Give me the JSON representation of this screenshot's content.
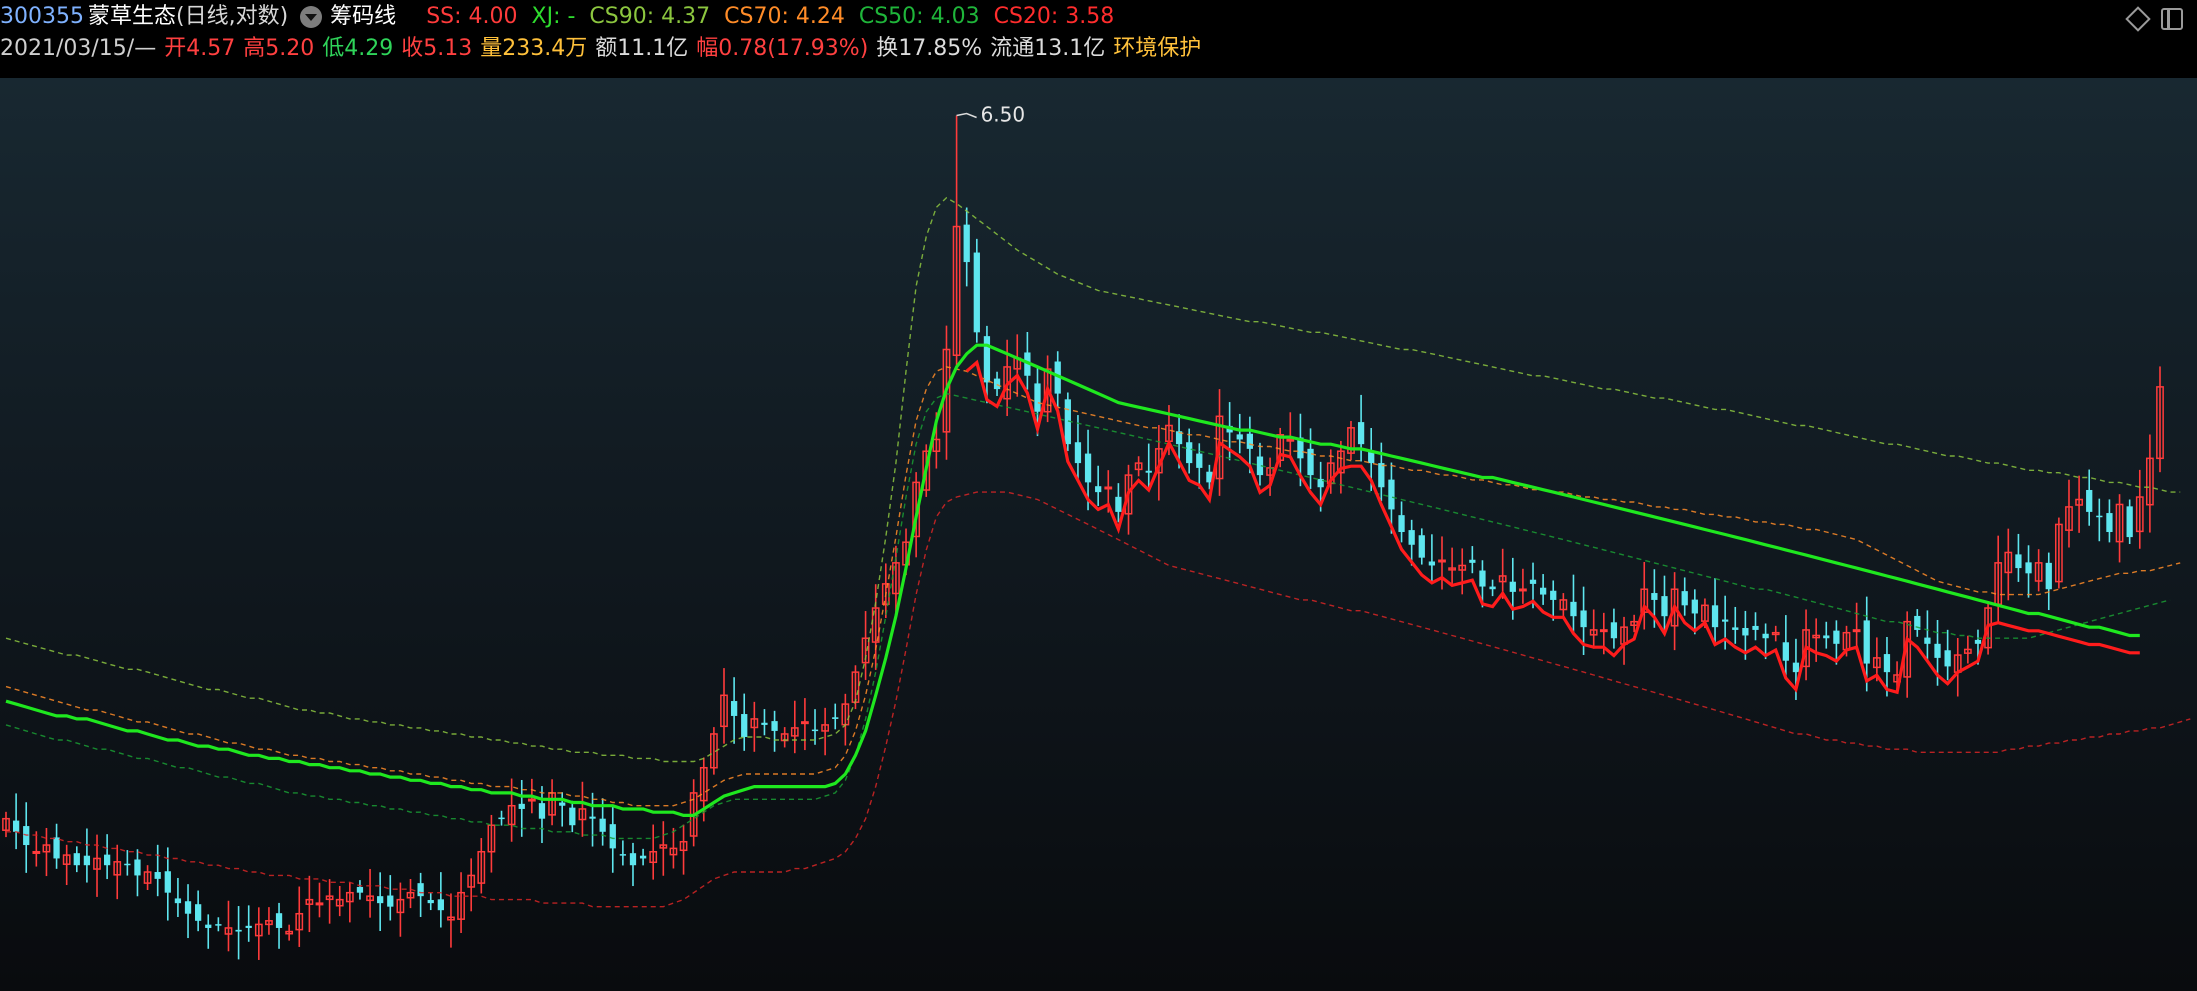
{
  "header": {
    "code": "300355",
    "name": "蒙草生态",
    "period": "(日线,对数)",
    "indicator_name": "筹码线",
    "ss": "SS: 4.00",
    "xj": "XJ: -",
    "cs90": "CS90: 4.37",
    "cs70": "CS70: 4.24",
    "cs50": "CS50: 4.03",
    "cs20": "CS20: 3.58",
    "date": "2021/03/15/—",
    "open_label": "开",
    "open": "4.57",
    "high_label": "高",
    "high": "5.20",
    "low_label": "低",
    "low": "4.29",
    "close_label": "收",
    "close": "5.13",
    "volume_label": "量",
    "volume": "233.4万",
    "amount_label": "额",
    "amount": "11.1亿",
    "change_label": "幅",
    "change": "0.78(17.93%)",
    "turnover_label": "换",
    "turnover": "17.85%",
    "float_label": "流通",
    "float": "13.1亿",
    "concept": "环境保护"
  },
  "icons": [
    "diamond-icon",
    "panel-toggle-icon"
  ],
  "colors": {
    "up": "#ff3b3b",
    "down": "#5ee6ef",
    "ss": "#ff1c1c",
    "xj": "#1fe81f",
    "cs90": "#8cc63f",
    "cs70": "#ff8c28",
    "cs50": "#1a9e34",
    "cs20": "#d82626"
  },
  "chart_data": {
    "type": "candlestick",
    "scale": "log",
    "ylim": [
      3.05,
      6.6
    ],
    "peak_label": "6.50",
    "peak_index": 94,
    "series_names": [
      "SS",
      "XJ",
      "CS90",
      "CS70",
      "CS50",
      "CS20"
    ],
    "closes": [
      3.52,
      3.48,
      3.44,
      3.42,
      3.44,
      3.4,
      3.41,
      3.38,
      3.38,
      3.4,
      3.38,
      3.39,
      3.38,
      3.35,
      3.36,
      3.34,
      3.3,
      3.27,
      3.24,
      3.22,
      3.2,
      3.21,
      3.2,
      3.19,
      3.2,
      3.21,
      3.22,
      3.2,
      3.19,
      3.24,
      3.28,
      3.27,
      3.29,
      3.28,
      3.3,
      3.3,
      3.29,
      3.27,
      3.26,
      3.28,
      3.3,
      3.29,
      3.27,
      3.25,
      3.23,
      3.3,
      3.35,
      3.42,
      3.5,
      3.52,
      3.56,
      3.55,
      3.58,
      3.52,
      3.6,
      3.56,
      3.5,
      3.55,
      3.52,
      3.48,
      3.43,
      3.41,
      3.38,
      3.4,
      3.42,
      3.44,
      3.43,
      3.45,
      3.6,
      3.68,
      3.79,
      3.92,
      3.85,
      3.78,
      3.84,
      3.82,
      3.8,
      3.79,
      3.81,
      3.83,
      3.8,
      3.82,
      3.84,
      3.89,
      4.0,
      4.12,
      4.23,
      4.32,
      4.4,
      4.48,
      4.72,
      4.85,
      4.9,
      5.3,
      5.9,
      5.72,
      5.38,
      5.15,
      5.12,
      5.22,
      5.26,
      5.18,
      5.02,
      5.21,
      5.1,
      4.88,
      4.8,
      4.72,
      4.68,
      4.7,
      4.6,
      4.75,
      4.8,
      4.76,
      4.86,
      4.96,
      4.88,
      4.8,
      4.78,
      4.72,
      5.0,
      4.93,
      4.9,
      4.86,
      4.75,
      4.78,
      4.92,
      4.9,
      4.82,
      4.75,
      4.7,
      4.8,
      4.85,
      4.95,
      4.88,
      4.8,
      4.7,
      4.61,
      4.52,
      4.47,
      4.42,
      4.39,
      4.41,
      4.38,
      4.39,
      4.4,
      4.31,
      4.3,
      4.35,
      4.29,
      4.3,
      4.32,
      4.28,
      4.26,
      4.26,
      4.2,
      4.16,
      4.15,
      4.15,
      4.12,
      4.16,
      4.18,
      4.3,
      4.26,
      4.2,
      4.3,
      4.24,
      4.21,
      4.24,
      4.16,
      4.18,
      4.15,
      4.13,
      4.15,
      4.12,
      4.14,
      4.04,
      4.0,
      4.15,
      4.13,
      4.12,
      4.1,
      4.14,
      4.15,
      4.03,
      4.05,
      4.0,
      3.99,
      4.18,
      4.15,
      4.1,
      4.05,
      4.02,
      4.06,
      4.08,
      4.1,
      4.23,
      4.4,
      4.44,
      4.38,
      4.36,
      4.4,
      4.3,
      4.55,
      4.62,
      4.65,
      4.6,
      4.58,
      4.52,
      4.63,
      4.5,
      4.66,
      4.82,
      5.13
    ],
    "ss": [
      3.9,
      3.89,
      3.88,
      3.87,
      3.86,
      3.85,
      3.85,
      3.84,
      3.84,
      3.83,
      3.82,
      3.81,
      3.8,
      3.8,
      3.79,
      3.78,
      3.77,
      3.77,
      3.76,
      3.75,
      3.75,
      3.74,
      3.74,
      3.73,
      3.72,
      3.72,
      3.71,
      3.71,
      3.7,
      3.7,
      3.69,
      3.69,
      3.68,
      3.68,
      3.67,
      3.67,
      3.66,
      3.66,
      3.65,
      3.65,
      3.64,
      3.64,
      3.63,
      3.63,
      3.62,
      3.62,
      3.61,
      3.61,
      3.6,
      3.6,
      3.6,
      3.59,
      3.59,
      3.58,
      3.58,
      3.58,
      3.57,
      3.57,
      3.56,
      3.56,
      3.56,
      3.55,
      3.55,
      3.55,
      3.54,
      3.54,
      3.54,
      3.53,
      3.53,
      3.55,
      3.57,
      3.59,
      3.6,
      3.61,
      3.62,
      3.62,
      3.62,
      3.62,
      3.62,
      3.62,
      3.62,
      3.62,
      3.63,
      3.66,
      3.72,
      3.8,
      3.92,
      4.05,
      4.2,
      4.38,
      4.58,
      4.78,
      4.98,
      5.12,
      5.22,
      5.28,
      5.32,
      5.32,
      5.3,
      5.28,
      5.26,
      5.24,
      5.22,
      5.2,
      5.18,
      5.16,
      5.14,
      5.12,
      5.1,
      5.08,
      5.06,
      5.05,
      5.04,
      5.03,
      5.02,
      5.01,
      5.0,
      4.99,
      4.98,
      4.97,
      4.96,
      4.95,
      4.94,
      4.94,
      4.93,
      4.92,
      4.91,
      4.91,
      4.9,
      4.89,
      4.88,
      4.88,
      4.87,
      4.86,
      4.86,
      4.85,
      4.84,
      4.83,
      4.82,
      4.81,
      4.8,
      4.79,
      4.78,
      4.77,
      4.76,
      4.75,
      4.74,
      4.74,
      4.73,
      4.72,
      4.71,
      4.7,
      4.69,
      4.68,
      4.67,
      4.66,
      4.65,
      4.64,
      4.63,
      4.62,
      4.61,
      4.6,
      4.59,
      4.58,
      4.57,
      4.56,
      4.55,
      4.54,
      4.53,
      4.52,
      4.51,
      4.5,
      4.49,
      4.48,
      4.47,
      4.46,
      4.45,
      4.44,
      4.43,
      4.42,
      4.41,
      4.4,
      4.39,
      4.38,
      4.37,
      4.36,
      4.35,
      4.34,
      4.33,
      4.32,
      4.31,
      4.3,
      4.29,
      4.28,
      4.27,
      4.26,
      4.25,
      4.24,
      4.23,
      4.22,
      4.21,
      4.21,
      4.2,
      4.19,
      4.18,
      4.17,
      4.16,
      4.16,
      4.15,
      4.14,
      4.13,
      4.13
    ],
    "xj_start": 95,
    "cs90": [
      4.12,
      4.11,
      4.1,
      4.09,
      4.08,
      4.07,
      4.06,
      4.06,
      4.05,
      4.04,
      4.03,
      4.02,
      4.01,
      4.01,
      4.0,
      3.99,
      3.98,
      3.97,
      3.96,
      3.95,
      3.94,
      3.94,
      3.93,
      3.92,
      3.91,
      3.91,
      3.9,
      3.89,
      3.88,
      3.87,
      3.87,
      3.86,
      3.86,
      3.85,
      3.84,
      3.84,
      3.83,
      3.83,
      3.82,
      3.82,
      3.81,
      3.81,
      3.8,
      3.8,
      3.79,
      3.79,
      3.78,
      3.78,
      3.77,
      3.77,
      3.76,
      3.76,
      3.75,
      3.75,
      3.74,
      3.74,
      3.73,
      3.73,
      3.73,
      3.72,
      3.72,
      3.72,
      3.71,
      3.71,
      3.71,
      3.7,
      3.7,
      3.7,
      3.7,
      3.71,
      3.73,
      3.75,
      3.77,
      3.78,
      3.78,
      3.78,
      3.77,
      3.77,
      3.77,
      3.77,
      3.77,
      3.78,
      3.79,
      3.82,
      3.9,
      4.05,
      4.25,
      4.5,
      4.8,
      5.2,
      5.6,
      5.85,
      6.0,
      6.05,
      6.02,
      5.98,
      5.94,
      5.9,
      5.86,
      5.82,
      5.78,
      5.75,
      5.72,
      5.69,
      5.66,
      5.64,
      5.62,
      5.6,
      5.58,
      5.57,
      5.56,
      5.55,
      5.54,
      5.53,
      5.52,
      5.51,
      5.5,
      5.49,
      5.48,
      5.47,
      5.46,
      5.45,
      5.44,
      5.43,
      5.43,
      5.42,
      5.41,
      5.4,
      5.39,
      5.38,
      5.38,
      5.37,
      5.36,
      5.35,
      5.34,
      5.33,
      5.32,
      5.31,
      5.3,
      5.3,
      5.29,
      5.28,
      5.27,
      5.26,
      5.25,
      5.24,
      5.23,
      5.22,
      5.21,
      5.2,
      5.19,
      5.18,
      5.18,
      5.17,
      5.16,
      5.15,
      5.14,
      5.13,
      5.12,
      5.12,
      5.11,
      5.1,
      5.09,
      5.08,
      5.08,
      5.07,
      5.06,
      5.05,
      5.04,
      5.03,
      5.03,
      5.02,
      5.01,
      5.0,
      4.99,
      4.98,
      4.97,
      4.96,
      4.96,
      4.95,
      4.94,
      4.93,
      4.92,
      4.91,
      4.9,
      4.89,
      4.88,
      4.88,
      4.87,
      4.86,
      4.85,
      4.84,
      4.83,
      4.83,
      4.82,
      4.81,
      4.8,
      4.8,
      4.79,
      4.78,
      4.77,
      4.77,
      4.76,
      4.76,
      4.75,
      4.74,
      4.74,
      4.73,
      4.72,
      4.72,
      4.71,
      4.7,
      4.7,
      4.69,
      4.68,
      4.68
    ],
    "cs70": [
      3.95,
      3.94,
      3.93,
      3.92,
      3.91,
      3.9,
      3.89,
      3.88,
      3.87,
      3.87,
      3.86,
      3.85,
      3.84,
      3.83,
      3.83,
      3.82,
      3.81,
      3.8,
      3.79,
      3.79,
      3.78,
      3.77,
      3.76,
      3.76,
      3.75,
      3.74,
      3.74,
      3.73,
      3.72,
      3.72,
      3.71,
      3.71,
      3.7,
      3.7,
      3.69,
      3.69,
      3.68,
      3.68,
      3.67,
      3.67,
      3.66,
      3.66,
      3.65,
      3.65,
      3.64,
      3.64,
      3.63,
      3.63,
      3.62,
      3.62,
      3.62,
      3.61,
      3.61,
      3.6,
      3.6,
      3.6,
      3.59,
      3.59,
      3.58,
      3.58,
      3.57,
      3.57,
      3.56,
      3.56,
      3.56,
      3.56,
      3.56,
      3.57,
      3.58,
      3.6,
      3.62,
      3.64,
      3.65,
      3.66,
      3.66,
      3.66,
      3.66,
      3.66,
      3.66,
      3.66,
      3.66,
      3.67,
      3.68,
      3.72,
      3.8,
      3.92,
      4.08,
      4.28,
      4.5,
      4.75,
      4.98,
      5.12,
      5.2,
      5.22,
      5.21,
      5.2,
      5.18,
      5.16,
      5.14,
      5.12,
      5.1,
      5.08,
      5.06,
      5.05,
      5.04,
      5.03,
      5.02,
      5.01,
      5.0,
      4.99,
      4.98,
      4.97,
      4.96,
      4.95,
      4.95,
      4.94,
      4.93,
      4.92,
      4.92,
      4.91,
      4.9,
      4.89,
      4.89,
      4.88,
      4.87,
      4.87,
      4.86,
      4.85,
      4.85,
      4.84,
      4.83,
      4.83,
      4.82,
      4.81,
      4.81,
      4.8,
      4.79,
      4.79,
      4.78,
      4.77,
      4.77,
      4.76,
      4.75,
      4.75,
      4.74,
      4.73,
      4.73,
      4.72,
      4.71,
      4.71,
      4.7,
      4.69,
      4.69,
      4.68,
      4.68,
      4.67,
      4.66,
      4.66,
      4.65,
      4.65,
      4.64,
      4.64,
      4.63,
      4.62,
      4.62,
      4.61,
      4.61,
      4.6,
      4.59,
      4.59,
      4.58,
      4.58,
      4.57,
      4.56,
      4.56,
      4.55,
      4.55,
      4.54,
      4.53,
      4.53,
      4.52,
      4.51,
      4.5,
      4.49,
      4.47,
      4.45,
      4.43,
      4.41,
      4.39,
      4.37,
      4.35,
      4.33,
      4.32,
      4.31,
      4.3,
      4.29,
      4.29,
      4.28,
      4.28,
      4.28,
      4.28,
      4.28,
      4.29,
      4.3,
      4.31,
      4.32,
      4.33,
      4.34,
      4.35,
      4.36,
      4.36,
      4.37,
      4.37,
      4.38,
      4.39,
      4.4
    ],
    "cs50": [
      3.82,
      3.81,
      3.8,
      3.79,
      3.78,
      3.77,
      3.77,
      3.76,
      3.75,
      3.74,
      3.74,
      3.73,
      3.72,
      3.71,
      3.71,
      3.7,
      3.69,
      3.68,
      3.68,
      3.67,
      3.66,
      3.65,
      3.65,
      3.64,
      3.63,
      3.63,
      3.62,
      3.61,
      3.6,
      3.6,
      3.59,
      3.59,
      3.58,
      3.58,
      3.57,
      3.57,
      3.56,
      3.56,
      3.55,
      3.55,
      3.54,
      3.54,
      3.53,
      3.53,
      3.52,
      3.52,
      3.51,
      3.51,
      3.5,
      3.5,
      3.5,
      3.49,
      3.49,
      3.49,
      3.48,
      3.48,
      3.48,
      3.47,
      3.47,
      3.47,
      3.46,
      3.46,
      3.46,
      3.46,
      3.46,
      3.47,
      3.48,
      3.5,
      3.52,
      3.54,
      3.56,
      3.57,
      3.58,
      3.58,
      3.58,
      3.58,
      3.58,
      3.58,
      3.58,
      3.58,
      3.58,
      3.59,
      3.6,
      3.64,
      3.72,
      3.84,
      4.0,
      4.2,
      4.42,
      4.66,
      4.88,
      5.02,
      5.08,
      5.1,
      5.09,
      5.08,
      5.07,
      5.06,
      5.05,
      5.04,
      5.03,
      5.02,
      5.01,
      5.0,
      4.99,
      4.98,
      4.97,
      4.96,
      4.95,
      4.94,
      4.93,
      4.92,
      4.91,
      4.9,
      4.89,
      4.88,
      4.87,
      4.86,
      4.85,
      4.84,
      4.83,
      4.82,
      4.81,
      4.8,
      4.79,
      4.78,
      4.77,
      4.76,
      4.75,
      4.74,
      4.73,
      4.72,
      4.71,
      4.7,
      4.69,
      4.68,
      4.67,
      4.66,
      4.65,
      4.64,
      4.63,
      4.62,
      4.61,
      4.6,
      4.59,
      4.58,
      4.57,
      4.56,
      4.55,
      4.54,
      4.53,
      4.52,
      4.51,
      4.5,
      4.49,
      4.48,
      4.47,
      4.46,
      4.45,
      4.44,
      4.43,
      4.42,
      4.41,
      4.4,
      4.39,
      4.38,
      4.37,
      4.36,
      4.35,
      4.34,
      4.33,
      4.32,
      4.31,
      4.3,
      4.3,
      4.29,
      4.28,
      4.27,
      4.26,
      4.25,
      4.24,
      4.23,
      4.22,
      4.21,
      4.2,
      4.19,
      4.18,
      4.18,
      4.17,
      4.16,
      4.15,
      4.14,
      4.14,
      4.13,
      4.13,
      4.12,
      4.12,
      4.12,
      4.12,
      4.12,
      4.12,
      4.13,
      4.14,
      4.15,
      4.16,
      4.17,
      4.18,
      4.19,
      4.2,
      4.21,
      4.22,
      4.23,
      4.24,
      4.25,
      4.26
    ],
    "cs20": [
      3.48,
      3.48,
      3.47,
      3.47,
      3.46,
      3.46,
      3.45,
      3.45,
      3.44,
      3.44,
      3.43,
      3.43,
      3.42,
      3.42,
      3.41,
      3.41,
      3.4,
      3.4,
      3.39,
      3.39,
      3.38,
      3.38,
      3.37,
      3.37,
      3.36,
      3.36,
      3.35,
      3.35,
      3.35,
      3.34,
      3.34,
      3.34,
      3.33,
      3.33,
      3.33,
      3.32,
      3.32,
      3.32,
      3.31,
      3.31,
      3.31,
      3.3,
      3.3,
      3.3,
      3.29,
      3.29,
      3.29,
      3.29,
      3.28,
      3.28,
      3.28,
      3.28,
      3.28,
      3.27,
      3.27,
      3.27,
      3.27,
      3.27,
      3.26,
      3.26,
      3.26,
      3.26,
      3.26,
      3.26,
      3.26,
      3.26,
      3.27,
      3.28,
      3.3,
      3.32,
      3.34,
      3.35,
      3.36,
      3.36,
      3.36,
      3.36,
      3.36,
      3.36,
      3.37,
      3.37,
      3.38,
      3.39,
      3.4,
      3.42,
      3.46,
      3.52,
      3.62,
      3.75,
      3.9,
      4.08,
      4.28,
      4.45,
      4.58,
      4.64,
      4.66,
      4.67,
      4.68,
      4.68,
      4.68,
      4.68,
      4.67,
      4.66,
      4.65,
      4.63,
      4.61,
      4.59,
      4.57,
      4.55,
      4.53,
      4.51,
      4.49,
      4.47,
      4.45,
      4.43,
      4.41,
      4.39,
      4.38,
      4.37,
      4.36,
      4.35,
      4.34,
      4.33,
      4.32,
      4.31,
      4.3,
      4.29,
      4.28,
      4.27,
      4.26,
      4.26,
      4.25,
      4.24,
      4.23,
      4.22,
      4.22,
      4.21,
      4.2,
      4.19,
      4.18,
      4.17,
      4.16,
      4.15,
      4.14,
      4.13,
      4.12,
      4.11,
      4.1,
      4.09,
      4.08,
      4.07,
      4.06,
      4.05,
      4.04,
      4.03,
      4.02,
      4.01,
      4.0,
      3.99,
      3.98,
      3.97,
      3.96,
      3.95,
      3.94,
      3.93,
      3.92,
      3.91,
      3.9,
      3.89,
      3.88,
      3.87,
      3.86,
      3.85,
      3.84,
      3.83,
      3.82,
      3.81,
      3.8,
      3.79,
      3.79,
      3.78,
      3.77,
      3.77,
      3.76,
      3.76,
      3.75,
      3.75,
      3.74,
      3.74,
      3.74,
      3.73,
      3.73,
      3.73,
      3.73,
      3.73,
      3.73,
      3.73,
      3.73,
      3.73,
      3.74,
      3.74,
      3.75,
      3.75,
      3.76,
      3.76,
      3.77,
      3.77,
      3.78,
      3.78,
      3.79,
      3.79,
      3.8,
      3.8,
      3.81,
      3.81,
      3.82,
      3.83,
      3.84
    ]
  }
}
